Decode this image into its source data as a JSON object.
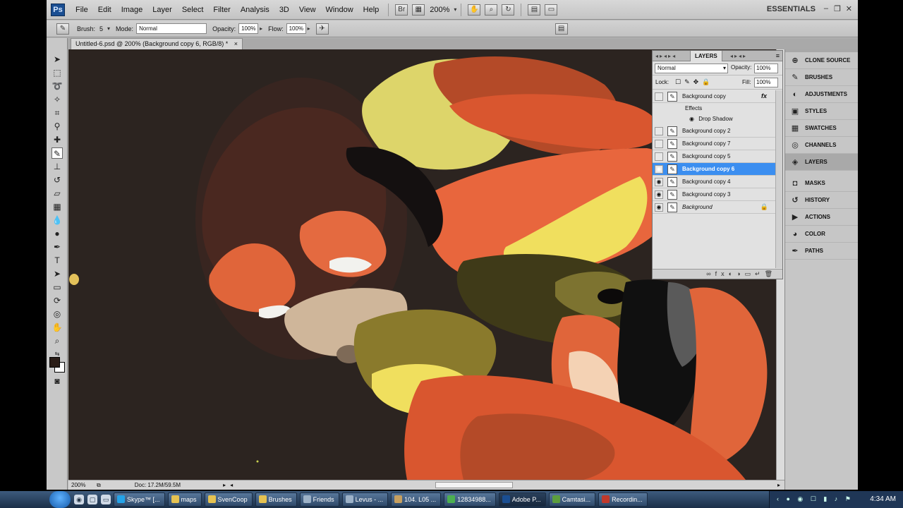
{
  "app": {
    "logo": "Ps"
  },
  "menu": [
    "File",
    "Edit",
    "Image",
    "Layer",
    "Select",
    "Filter",
    "Analysis",
    "3D",
    "View",
    "Window",
    "Help"
  ],
  "menubar": {
    "zoom": "200%",
    "workspace": "ESSENTIALS"
  },
  "options": {
    "brush_label": "Brush:",
    "brush_size": "5",
    "mode_label": "Mode:",
    "mode_value": "Normal",
    "opacity_label": "Opacity:",
    "opacity_value": "100%",
    "flow_label": "Flow:",
    "flow_value": "100%"
  },
  "document": {
    "tab_title": "Untitled-6.psd @ 200% (Background copy 6, RGB/8) *",
    "close": "×"
  },
  "status": {
    "zoom": "200%",
    "doc_size": "Doc: 17.2M/59.5M"
  },
  "colors": {
    "foreground": "#2a1d17",
    "background": "#ffffff",
    "selection": "#3b8ef0"
  },
  "layers_panel": {
    "tab_label": "LAYERS",
    "blend_mode": "Normal",
    "opacity_label": "Opacity:",
    "opacity_value": "100%",
    "lock_label": "Lock:",
    "fill_label": "Fill:",
    "fill_value": "100%",
    "effects_label": "Effects",
    "drop_shadow_label": "Drop Shadow",
    "layers": [
      {
        "name": "Background copy",
        "visible": false,
        "fx": "fx"
      },
      {
        "name": "Background copy 2",
        "visible": false
      },
      {
        "name": "Background copy 7",
        "visible": false
      },
      {
        "name": "Background copy 5",
        "visible": false
      },
      {
        "name": "Background copy 6",
        "visible": true,
        "selected": true
      },
      {
        "name": "Background copy 4",
        "visible": true
      },
      {
        "name": "Background copy 3",
        "visible": true
      },
      {
        "name": "Background",
        "visible": true,
        "locked": true
      }
    ]
  },
  "dock": [
    "CLONE SOURCE",
    "BRUSHES",
    "ADJUSTMENTS",
    "STYLES",
    "SWATCHES",
    "CHANNELS",
    "LAYERS",
    "MASKS",
    "HISTORY",
    "ACTIONS",
    "COLOR",
    "PATHS"
  ],
  "taskbar": {
    "items": [
      "Skype™ [...",
      "maps",
      "SvenCoop",
      "Brushes",
      "Friends",
      "Levus - ...",
      "104. L05 ...",
      "12834988...",
      "Adobe P...",
      "Camtasi...",
      "Recordin..."
    ],
    "clock": "4:34 AM"
  }
}
